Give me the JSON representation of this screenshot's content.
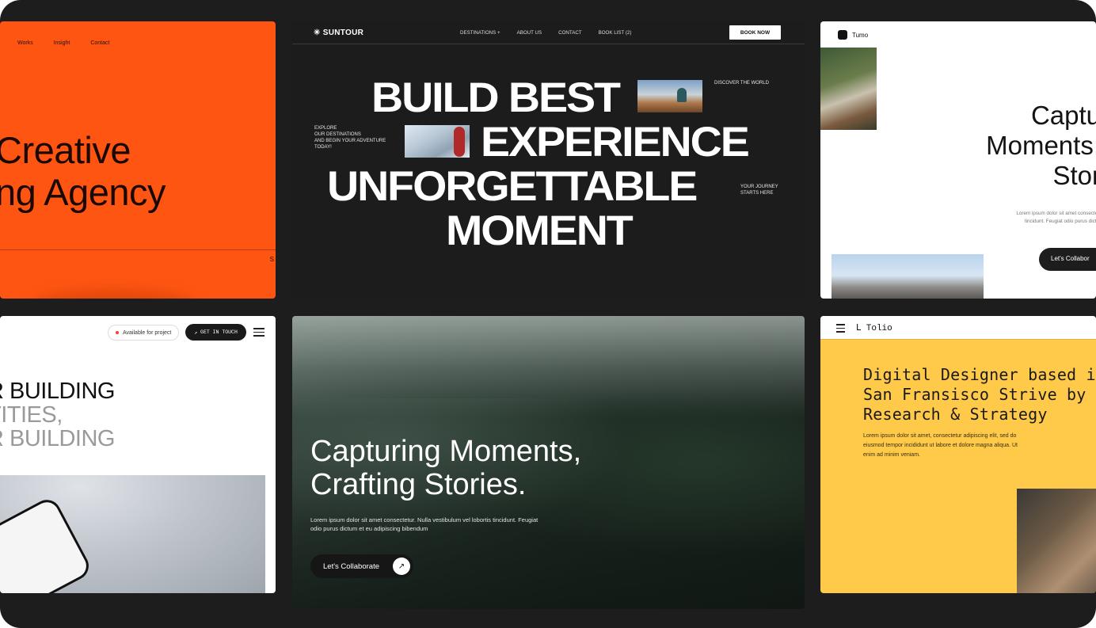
{
  "agency": {
    "nav": [
      "Works",
      "Insight",
      "Contact"
    ],
    "headline": [
      "Creative",
      "ng Agency"
    ],
    "edge_letter": "S"
  },
  "suntour": {
    "logo": "SUNTOUR",
    "menu": [
      "DESTINATIONS +",
      "ABOUT US",
      "CONTACT",
      "BOOK LIST (2)"
    ],
    "book_button": "BOOK NOW",
    "headline_1": "BUILD BEST",
    "headline_2": "EXPERIENCE",
    "headline_3": "UNFORGETTABLE",
    "headline_4": "MOMENT",
    "discover": "DISCOVER THE WORLD",
    "explore": [
      "EXPLORE",
      "OUR DESTINATIONS",
      "AND BEGIN YOUR ADVENTURE",
      "TODAY!"
    ],
    "journey": [
      "YOUR JOURNEY",
      "STARTS HERE"
    ]
  },
  "tumo": {
    "brand": "Tumo",
    "headline": [
      "Captu",
      "Moments,",
      "Stor"
    ],
    "body": [
      "Lorem ipsum dolor sit amet consectet",
      "tincidunt. Feugiat odio purus dictu"
    ],
    "cta": "Let's Collabor"
  },
  "building": {
    "available": "Available for project",
    "touch_button": "GET IN TOUCH",
    "headline_1": "R BUILDING",
    "headline_2": "TITIES,",
    "headline_3": "R BUILDING"
  },
  "forest": {
    "headline": [
      "Capturing Moments,",
      "Crafting Stories."
    ],
    "body": "Lorem ipsum dolor sit amet consectetur. Nulla vestibulum vel lobortis tincidunt. Feugiat odio purus dictum et eu adipiscing bibendum",
    "cta": "Let's Collaborate"
  },
  "tolio": {
    "brand": "Tolio",
    "headline": [
      "Digital Designer based i",
      "San Fransisco Strive by",
      "Research & Strategy"
    ],
    "body": "Lorem ipsum dolor sit amet, consectetur adipiscing elit, sed do eiusmod tempor incididunt ut labore et dolore magna aliqua. Ut enim ad minim veniam."
  },
  "colors": {
    "frame": "#1d1d1d",
    "agency_orange": "#fe5513",
    "tolio_yellow": "#ffc94a"
  }
}
